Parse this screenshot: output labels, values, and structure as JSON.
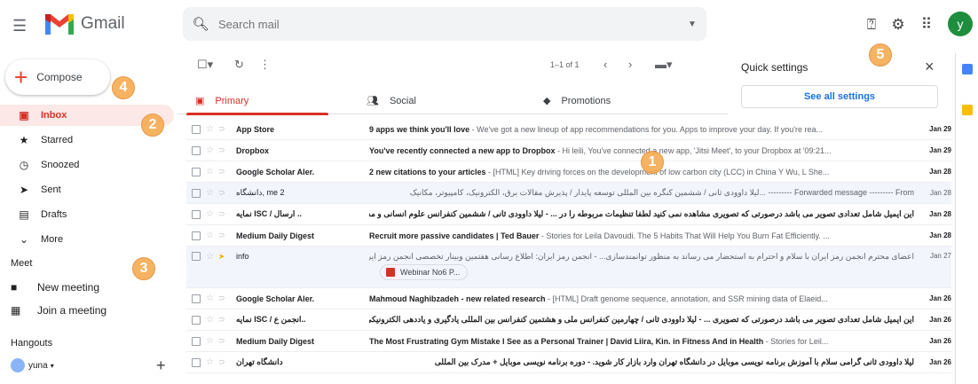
{
  "header": {
    "app_name": "Gmail",
    "search_placeholder": "Search mail",
    "avatar_letter": "y"
  },
  "sidebar": {
    "compose_label": "Compose",
    "items": [
      {
        "label": "Inbox",
        "icon": "inbox-icon",
        "active": true
      },
      {
        "label": "Starred",
        "icon": "star-icon"
      },
      {
        "label": "Snoozed",
        "icon": "clock-icon"
      },
      {
        "label": "Sent",
        "icon": "send-icon"
      },
      {
        "label": "Drafts",
        "icon": "draft-icon"
      },
      {
        "label": "More",
        "icon": "chevron-down-icon"
      }
    ],
    "meet_label": "Meet",
    "meet_items": [
      {
        "label": "New meeting",
        "icon": "video-icon"
      },
      {
        "label": "Join a meeting",
        "icon": "keyboard-icon"
      }
    ],
    "hangouts_label": "Hangouts",
    "hangouts_user": "yuna"
  },
  "toolbar": {
    "pager": "1–1 of 1"
  },
  "tabs": [
    {
      "label": "Primary",
      "icon": "inbox-icon"
    },
    {
      "label": "Social",
      "icon": "people-icon"
    },
    {
      "label": "Promotions",
      "icon": "tag-icon"
    }
  ],
  "quick_settings": {
    "title": "Quick settings",
    "button": "See all settings"
  },
  "badges": [
    "1",
    "2",
    "3",
    "4",
    "5"
  ],
  "emails": [
    {
      "sender": "App Store",
      "subject": "9 apps we think you'll love",
      "snippet": " - We've got a new lineup of app recommendations for you. Apps to improve your day. If you're rea...",
      "date": "Jan 29",
      "read": false
    },
    {
      "sender": "Dropbox",
      "subject": "You've recently connected a new app to Dropbox",
      "snippet": " - Hi leili, You've connected a new app, 'Jitsi Meet', to your Dropbox at '09:21...",
      "date": "Jan 29",
      "read": false
    },
    {
      "sender": "Google Scholar Aler.",
      "subject": "2 new citations to your articles",
      "snippet": " - [HTML] Key driving forces on the development of low carbon city (LCC) in China Y Wu, L She...",
      "date": "Jan 28",
      "read": false
    },
    {
      "sender": "دانشگاه, me 2",
      "subject": "",
      "snippet": "Forwarded message --------- From --------- ...لیلا داوودی ثانی / ششمین کنگره بین المللی توسعه پایدار / پذیرش مقالات برق، الکترونیک، کامپیوتر، مکانیک",
      "date": "Jan 28",
      "read": true
    },
    {
      "sender": "نمایه ISC / ارسال ..",
      "subject": "",
      "snippet": "این ایمیل شامل تعدادی تصویر می باشد درصورتی که تصویری مشاهده نمی کنید لطفا تنظیمات مربوطه را در ... - لیلا داوودی ثانی / ششمین کنفرانس علوم انسانی و مدیریت",
      "date": "Jan 28",
      "read": false
    },
    {
      "sender": "Medium Daily Digest",
      "subject": "Recruit more passive candidates | Ted Bauer",
      "snippet": " - Stories for Leila Davoudi. The 5 Habits That Will Help You Burn Fat Efficiently. ...",
      "date": "Jan 28",
      "read": false
    },
    {
      "sender": "info",
      "subject": "",
      "snippet": "اعضای محترم انجمن رمز ایران با سلام و احترام به استحضار می رساند به منظور توانمندسازی... - انجمن رمز ایران: اطلاع رسانی هفتمین وبینار تخصصی انجمن رمز ایران",
      "date": "Jan 27",
      "read": true,
      "attachment": "Webinar No6 P...",
      "important": true
    },
    {
      "sender": "Google Scholar Aler.",
      "subject": "Mahmoud Naghibzadeh - new related research",
      "snippet": " - [HTML] Draft genome sequence, annotation, and SSR mining data of Elaeid...",
      "date": "Jan 26",
      "read": false
    },
    {
      "sender": "نمایه ISC / انجمن ع..",
      "subject": "",
      "snippet": "این ایمیل شامل تعدادی تصویر می باشد درصورتی که تصویری ... - لیلا داوودی ثانی / چهارمین کنفرانس ملی و هشتمین کنفرانس بین المللی یادگیری و یاددهی الکترونیکی",
      "date": "Jan 26",
      "read": false
    },
    {
      "sender": "Medium Daily Digest",
      "subject": "The Most Frustrating Gym Mistake I See as a Personal Trainer | David Liira, Kin. in Fitness And in Health",
      "snippet": " - Stories for Leil...",
      "date": "Jan 26",
      "read": false
    },
    {
      "sender": "دانشگاه تهران",
      "subject": "",
      "snippet": "لیلا داوودی ثانی گرامی سلام با آموزش برنامه نویسی موبایل در دانشگاه تهران وارد بازار کار شوید. - دوره برنامه نویسی موبایل + مدرک بین المللی",
      "date": "Jan 26",
      "read": false
    }
  ]
}
